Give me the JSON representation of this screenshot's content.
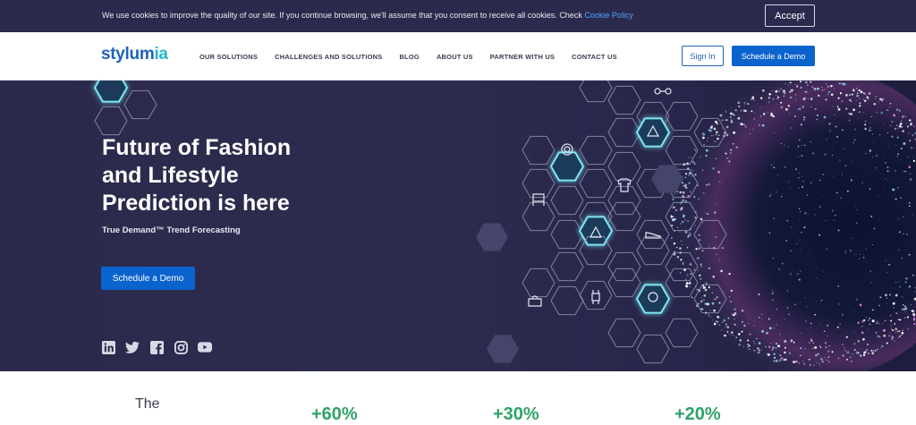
{
  "cookie": {
    "text": "We use cookies to improve the quality of our site. If you continue browsing, we'll assume that you consent to receive all cookies. Check ",
    "link": "Cookie Policy",
    "accept": "Accept"
  },
  "header": {
    "logo_main": "stylum",
    "logo_accent": "ia",
    "nav": [
      "OUR SOLUTIONS",
      "CHALLENGES AND SOLUTIONS",
      "BLOG",
      "ABOUT US",
      "PARTNER WITH US",
      "CONTACT US"
    ],
    "signin": "Sign In",
    "demo": "Schedule a Demo"
  },
  "hero": {
    "title": "Future of Fashion and Lifestyle Prediction is here",
    "subtitle": "True Demand™ Trend Forecasting",
    "cta": "Schedule a Demo",
    "socials": [
      "linkedin-icon",
      "twitter-icon",
      "facebook-icon",
      "instagram-icon",
      "youtube-icon"
    ]
  },
  "stats": {
    "intro": "The",
    "values": [
      "+60%",
      "+30%",
      "+20%"
    ]
  },
  "colors": {
    "brand": "#1f63b7",
    "button": "#0b63ce",
    "hero_bg": "#2b2a4c",
    "stat": "#2fa36b"
  }
}
